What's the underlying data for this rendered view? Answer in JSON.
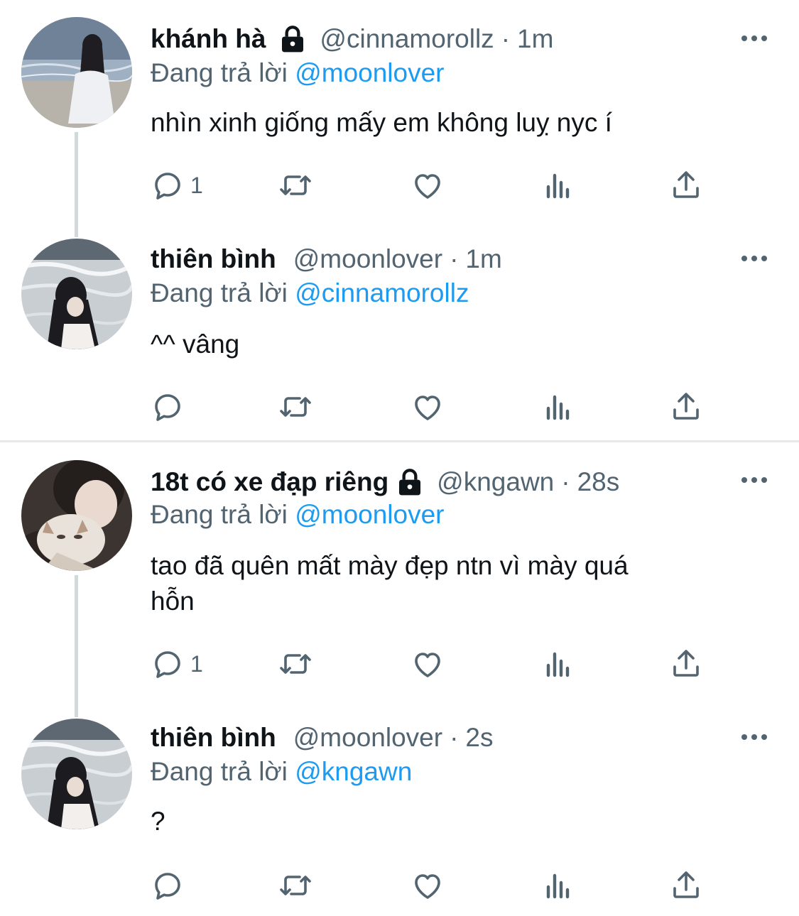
{
  "accent_color": "#1d9bf0",
  "tweets": [
    {
      "name": "khánh hà",
      "locked": true,
      "handle": "@cinnamorollz",
      "sep": "·",
      "time": "1m",
      "replying_prefix": "Đang trả lời",
      "replying_to": "@moonlover",
      "text": "nhìn xinh giống mấy em không luỵ nyc í",
      "reply_count": "1",
      "avatar": "beach-girl-white-dress-photo"
    },
    {
      "name": "thiên bình",
      "locked": false,
      "handle": "@moonlover",
      "sep": "·",
      "time": "1m",
      "replying_prefix": "Đang trả lời",
      "replying_to": "@cinnamorollz",
      "text": "^^ vâng",
      "reply_count": "",
      "avatar": "girl-by-the-sea-photo"
    },
    {
      "name": "18t có xe đạp riêng",
      "locked": true,
      "handle": "@kngawn",
      "sep": "·",
      "time": "28s",
      "replying_prefix": "Đang trả lời",
      "replying_to": "@moonlover",
      "text_line1": "tao đã quên mất mày đẹp ntn vì mày quá",
      "text_line2": "hỗn",
      "reply_count": "1",
      "avatar": "girl-with-cat-photo"
    },
    {
      "name": "thiên bình",
      "locked": false,
      "handle": "@moonlover",
      "sep": "·",
      "time": "2s",
      "replying_prefix": "Đang trả lời",
      "replying_to": "@kngawn",
      "text": "?",
      "reply_count": "",
      "avatar": "girl-by-the-sea-photo"
    }
  ]
}
